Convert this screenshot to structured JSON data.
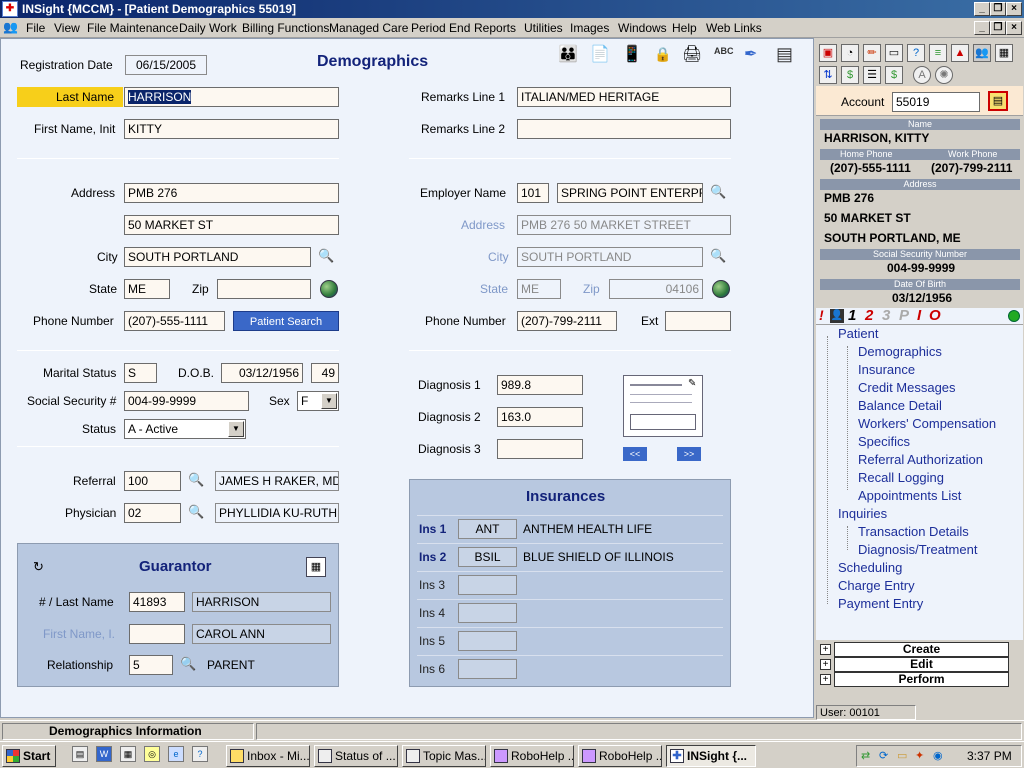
{
  "window": {
    "title": "INSight {MCCM} - [Patient Demographics 55019]",
    "menu_icon": "app-icon"
  },
  "menu": [
    "File",
    "View",
    "File Maintenance",
    "Daily Work",
    "Billing Functions",
    "Managed Care",
    "Period End",
    "Reports",
    "Utilities",
    "Images",
    "Windows",
    "Help",
    "Web Links"
  ],
  "form": {
    "title": "Demographics",
    "registration_date_label": "Registration Date",
    "registration_date": "06/15/2005",
    "last_name_label": "Last Name",
    "last_name": "HARRISON",
    "first_name_label": "First Name, Init",
    "first_name": "KITTY",
    "address_label": "Address",
    "address1": "PMB 276",
    "address2": "50 MARKET ST",
    "city_label": "City",
    "city": "SOUTH PORTLAND",
    "state_label": "State",
    "state": "ME",
    "zip_label": "Zip",
    "zip": "",
    "phone_label": "Phone Number",
    "phone": "(207)-555-1111",
    "patient_search": "Patient Search",
    "marital_label": "Marital Status",
    "marital": "S",
    "dob_label": "D.O.B.",
    "dob": "03/12/1956",
    "age": "49",
    "ssn_label": "Social Security #",
    "ssn": "004-99-9999",
    "sex_label": "Sex",
    "sex": "F",
    "status_label": "Status",
    "status": "A - Active",
    "referral_label": "Referral",
    "referral_code": "100",
    "referral_name": "JAMES H RAKER, MD",
    "physician_label": "Physician",
    "physician_code": "02",
    "physician_name": "PHYLLIDIA KU-RUTH",
    "remarks1_label": "Remarks Line 1",
    "remarks1": "ITALIAN/MED HERITAGE",
    "remarks2_label": "Remarks Line 2",
    "remarks2": "",
    "employer_label": "Employer Name",
    "employer_code": "101",
    "employer_name": "SPRING POINT ENTERPR",
    "emp_address_label": "Address",
    "emp_address": "PMB 276 50 MARKET STREET",
    "emp_city_label": "City",
    "emp_city": "SOUTH PORTLAND",
    "emp_state_label": "State",
    "emp_state": "ME",
    "emp_zip_label": "Zip",
    "emp_zip": "04106",
    "emp_phone_label": "Phone Number",
    "emp_phone": "(207)-799-2111",
    "ext_label": "Ext",
    "ext": "",
    "diag1_label": "Diagnosis 1",
    "diag1": "989.8",
    "diag2_label": "Diagnosis 2",
    "diag2": "163.0",
    "diag3_label": "Diagnosis 3",
    "diag3": "",
    "prev_btn": "<<",
    "next_btn": ">>"
  },
  "guarantor": {
    "title": "Guarantor",
    "num_label": "# / Last Name",
    "num": "41893",
    "last_name": "HARRISON",
    "first_label": "First Name, I.",
    "first_init": "",
    "first_name": "CAROL ANN",
    "relationship_label": "Relationship",
    "relationship_code": "5",
    "relationship": "PARENT"
  },
  "insurances": {
    "title": "Insurances",
    "rows": [
      {
        "label": "Ins 1",
        "code": "ANT",
        "name": "ANTHEM HEALTH LIFE"
      },
      {
        "label": "Ins 2",
        "code": "BSIL",
        "name": "BLUE SHIELD OF ILLINOIS"
      },
      {
        "label": "Ins 3",
        "code": "",
        "name": ""
      },
      {
        "label": "Ins 4",
        "code": "",
        "name": ""
      },
      {
        "label": "Ins 5",
        "code": "",
        "name": ""
      },
      {
        "label": "Ins 6",
        "code": "",
        "name": ""
      }
    ]
  },
  "side": {
    "account_label": "Account",
    "account": "55019",
    "name_hdr": "Name",
    "name": "HARRISON, KITTY",
    "home_phone_hdr": "Home Phone",
    "work_phone_hdr": "Work Phone",
    "home_phone": "(207)-555-1111",
    "work_phone": "(207)-799-2111",
    "address_hdr": "Address",
    "addr1": "PMB 276",
    "addr2": "50 MARKET ST",
    "addr3": "SOUTH PORTLAND, ME",
    "ssn_hdr": "Social Security Number",
    "ssn": "004-99-9999",
    "dob_hdr": "Date Of Birth",
    "dob": "03/12/1956",
    "badges": [
      "!",
      "1",
      "2",
      "3",
      "P",
      "I",
      "O"
    ],
    "tree": {
      "patient": "Patient",
      "patient_items": [
        "Demographics",
        "Insurance",
        "Credit Messages",
        "Balance Detail",
        "Workers' Compensation",
        "Specifics",
        "Referral Authorization",
        "Recall Logging",
        "Appointments List"
      ],
      "inquiries": "Inquiries",
      "inquiries_items": [
        "Transaction Details",
        "Diagnosis/Treatment"
      ],
      "scheduling": "Scheduling",
      "charge_entry": "Charge Entry",
      "payment_entry": "Payment Entry"
    },
    "create": "Create",
    "edit": "Edit",
    "perform": "Perform",
    "user": "User: 00101"
  },
  "status": {
    "text": "Demographics Information"
  },
  "taskbar": {
    "start": "Start",
    "tasks": [
      "Inbox - Mi...",
      "Status of ...",
      "Topic Mas...",
      "RoboHelp ...",
      "RoboHelp ...",
      "INSight {..."
    ],
    "clock": "3:37 PM"
  }
}
